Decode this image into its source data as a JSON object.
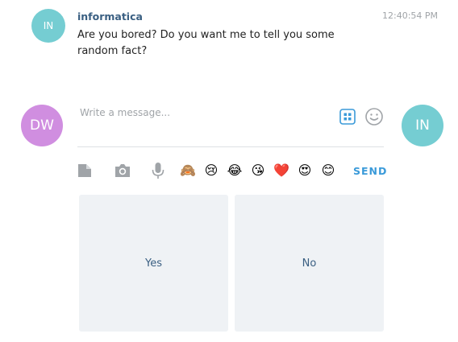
{
  "message": {
    "avatar_initials": "IN",
    "sender": "informatica",
    "time": "12:40:54 PM",
    "text": "Are you bored? Do you want me to tell you some random fact?"
  },
  "composer": {
    "user_initials": "DW",
    "bot_initials": "IN",
    "placeholder": "Write a message...",
    "value": ""
  },
  "toolbar": {
    "icons": [
      "file-icon",
      "camera-icon",
      "microphone-icon"
    ],
    "emojis": [
      "🙈",
      "😢",
      "😂",
      "😘",
      "❤️",
      "😍",
      "😊"
    ],
    "send_label": "SEND"
  },
  "quick_replies": [
    "Yes",
    "No"
  ],
  "colors": {
    "bot_avatar": "#75cdd2",
    "user_avatar": "#d08ee0",
    "sender_name": "#3a5f82",
    "send": "#3a9ad9",
    "reply_bg": "#eff2f5"
  }
}
